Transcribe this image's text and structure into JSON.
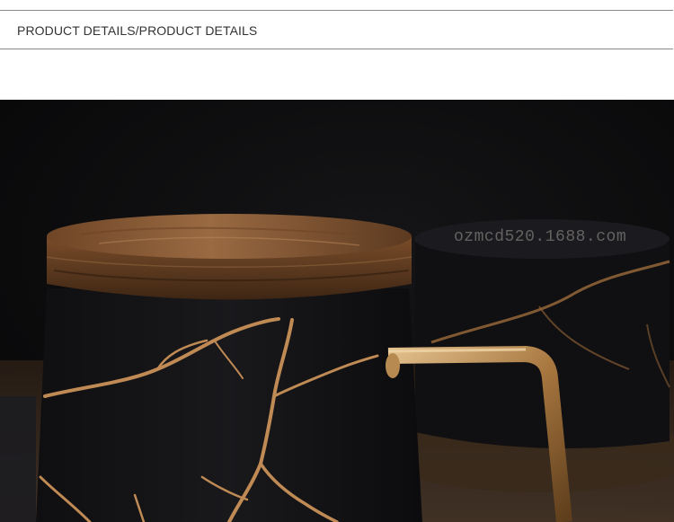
{
  "section": {
    "title": "PRODUCT DETAILS/PRODUCT DETAILS"
  },
  "product_image": {
    "watermark": "ozmcd520.1688.com",
    "subject": "black marble ceramic mug with wooden lid and gold handle",
    "colors": {
      "background": "#0b0b0c",
      "mug": "#141416",
      "gold": "#c08a55",
      "wood": "#8b5a34"
    }
  }
}
